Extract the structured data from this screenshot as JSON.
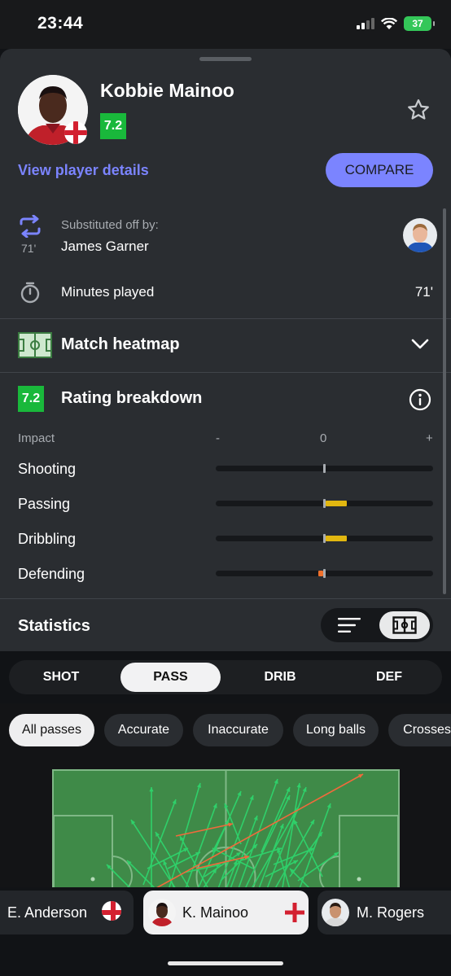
{
  "status": {
    "time": "23:44",
    "battery": "37"
  },
  "player": {
    "name": "Kobbie Mainoo",
    "rating": "7.2",
    "details_link": "View player details",
    "compare_label": "COMPARE"
  },
  "substitution": {
    "minute": "71'",
    "label": "Substituted off by:",
    "name": "James Garner"
  },
  "minutes": {
    "label": "Minutes played",
    "value": "71'"
  },
  "heatmap": {
    "title": "Match heatmap"
  },
  "rating_breakdown": {
    "title": "Rating breakdown",
    "rating": "7.2",
    "impact_label": "Impact",
    "axis": {
      "minus": "-",
      "zero": "0",
      "plus": "+"
    },
    "rows": [
      {
        "label": "Shooting",
        "impact": 0.0
      },
      {
        "label": "Passing",
        "impact": 0.2
      },
      {
        "label": "Dribbling",
        "impact": 0.2
      },
      {
        "label": "Defending",
        "impact": -0.05
      }
    ],
    "colors": {
      "positive": "#e2b710",
      "negative": "#f0702b"
    }
  },
  "statistics": {
    "title": "Statistics"
  },
  "tabs": [
    {
      "label": "SHOT",
      "active": false
    },
    {
      "label": "PASS",
      "active": true
    },
    {
      "label": "DRIB",
      "active": false
    },
    {
      "label": "DEF",
      "active": false
    }
  ],
  "filters": [
    "All passes",
    "Accurate",
    "Inaccurate",
    "Long balls",
    "Crosses"
  ],
  "pass_map": {
    "accurate_color": "#2fd06a",
    "inaccurate_color": "#f06a3c"
  },
  "player_switcher": [
    {
      "name": "E. Anderson",
      "active": false
    },
    {
      "name": "K. Mainoo",
      "active": true
    },
    {
      "name": "M. Rogers",
      "active": false
    }
  ]
}
